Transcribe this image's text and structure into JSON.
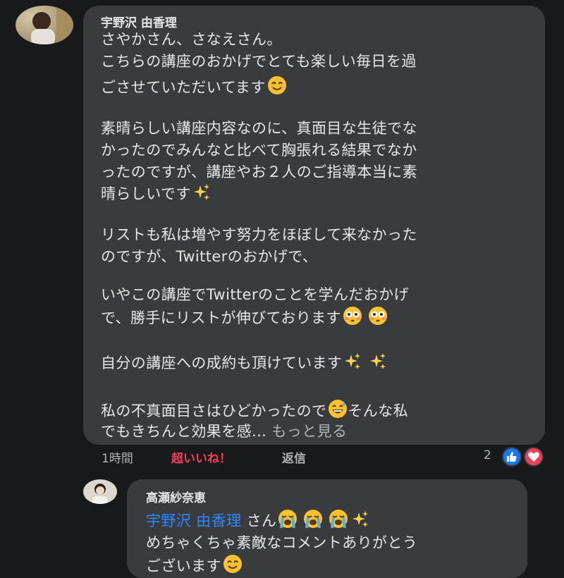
{
  "comment1": {
    "author": "宇野沢 由香理",
    "paragraphs": [
      "さやかさん、さなえさん。",
      "こちらの講座のおかげでとても楽しい毎日を過",
      "ごさせていただいてます",
      "素晴らしい講座内容なのに、真面目な生徒でな",
      "かったのでみんなと比べて胸張れる結果でなか",
      "ったのですが、講座やお２人のご指導本当に素",
      "晴らしいです",
      "リストも私は増やす努力をほぼして来なかった",
      "のですが、Twitterのおかげで、",
      "いやこの講座でTwitterのことを学んだおかげ",
      "で、勝手にリストが伸びております",
      "自分の講座への成約も頂けています",
      "私の不真面目さはひどかったので",
      "そんな私",
      "でもきちんと効果を感..."
    ],
    "see_more": "もっと見る",
    "actions": {
      "time": "1時間",
      "reaction": "超いいね！",
      "reply": "返信"
    },
    "reaction_count": "2"
  },
  "comment2": {
    "author": "高瀬紗奈恵",
    "mention": "宇野沢 由香理",
    "mention_suffix": "さん",
    "line2": "めちゃくちゃ素敵なコメントありがとう",
    "line3": "ございます"
  },
  "colors": {
    "background": "#18191a",
    "bubble": "#3a3b3c",
    "text": "#e4e6eb",
    "muted": "#b0b3b8",
    "reaction_active": "#f33e58",
    "mention": "#2d88ff",
    "like": "#1877f2"
  }
}
